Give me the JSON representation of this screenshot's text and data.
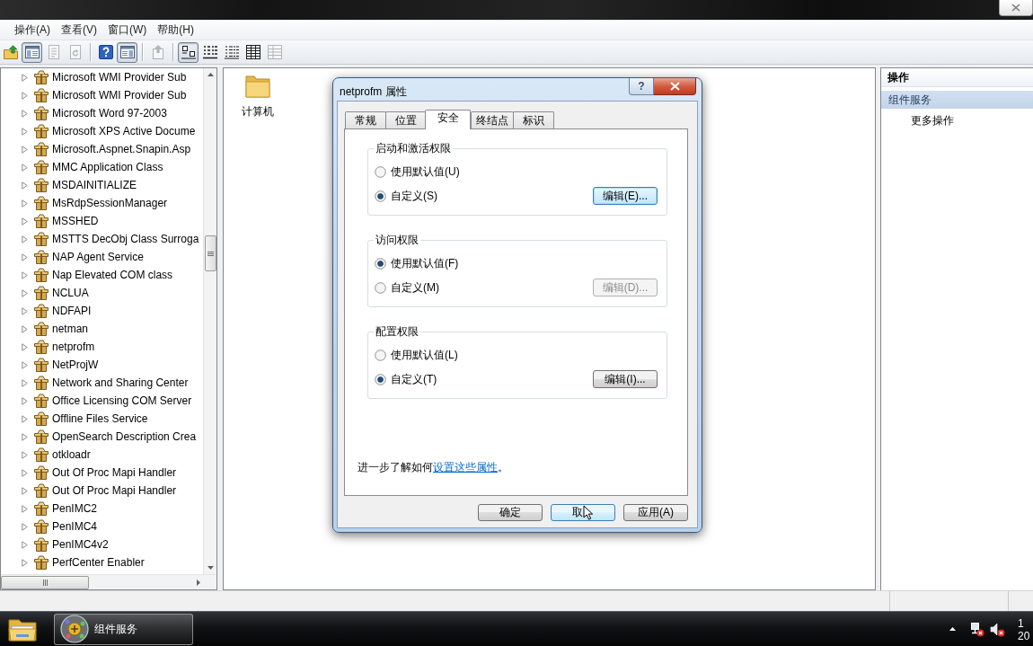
{
  "menu_bar": [
    "操作(A)",
    "查看(V)",
    "窗口(W)",
    "帮助(H)"
  ],
  "toolbar": {
    "groups": [
      [
        {
          "kind": "up",
          "pressed": false,
          "disabled": false
        },
        {
          "kind": "console-tree",
          "pressed": true,
          "disabled": false
        },
        {
          "kind": "properties",
          "pressed": false,
          "disabled": true
        },
        {
          "kind": "refresh",
          "pressed": false,
          "disabled": true
        }
      ],
      [
        {
          "kind": "help",
          "pressed": false,
          "disabled": false
        },
        {
          "kind": "action-pane",
          "pressed": true,
          "disabled": false
        }
      ],
      [
        {
          "kind": "export",
          "pressed": false,
          "disabled": true
        }
      ],
      [
        {
          "kind": "large-icons",
          "pressed": true,
          "disabled": false
        },
        {
          "kind": "small-icons",
          "pressed": false,
          "disabled": false
        },
        {
          "kind": "list",
          "pressed": false,
          "disabled": false
        },
        {
          "kind": "details",
          "pressed": false,
          "disabled": false
        },
        {
          "kind": "customize",
          "pressed": false,
          "disabled": true
        }
      ]
    ]
  },
  "tree": {
    "items": [
      {
        "label": "Microsoft WMI Provider Sub",
        "expanded": false
      },
      {
        "label": "Microsoft WMI Provider Sub",
        "expanded": false
      },
      {
        "label": "Microsoft Word 97-2003",
        "expanded": false
      },
      {
        "label": "Microsoft XPS Active Docume",
        "expanded": false
      },
      {
        "label": "Microsoft.Aspnet.Snapin.Asp",
        "expanded": false
      },
      {
        "label": "MMC Application Class",
        "expanded": false
      },
      {
        "label": "MSDAINITIALIZE",
        "expanded": false
      },
      {
        "label": "MsRdpSessionManager",
        "expanded": false
      },
      {
        "label": "MSSHED",
        "expanded": false
      },
      {
        "label": "MSTTS DecObj Class Surroga",
        "expanded": false
      },
      {
        "label": "NAP Agent Service",
        "expanded": false
      },
      {
        "label": "Nap Elevated COM class",
        "expanded": false
      },
      {
        "label": "NCLUA",
        "expanded": false
      },
      {
        "label": "NDFAPI",
        "expanded": false
      },
      {
        "label": "netman",
        "expanded": false
      },
      {
        "label": "netprofm",
        "expanded": false
      },
      {
        "label": "NetProjW",
        "expanded": false
      },
      {
        "label": "Network and Sharing Center",
        "expanded": false
      },
      {
        "label": "Office Licensing COM Server",
        "expanded": false
      },
      {
        "label": "Offline Files Service",
        "expanded": false
      },
      {
        "label": "OpenSearch Description Crea",
        "expanded": false
      },
      {
        "label": "otkloadr",
        "expanded": false
      },
      {
        "label": "Out Of Proc Mapi Handler",
        "expanded": false
      },
      {
        "label": "Out Of Proc Mapi Handler",
        "expanded": false
      },
      {
        "label": "PenIMC2",
        "expanded": false
      },
      {
        "label": "PenIMC4",
        "expanded": false
      },
      {
        "label": "PenIMC4v2",
        "expanded": false
      },
      {
        "label": "PerfCenter Enabler",
        "expanded": false
      }
    ]
  },
  "content": {
    "items": [
      {
        "kind": "folder",
        "label": "计算机"
      }
    ]
  },
  "actions": {
    "header": "操作",
    "items": [
      {
        "kind": "section",
        "label": "组件服务"
      },
      {
        "kind": "action",
        "label": "更多操作"
      }
    ]
  },
  "dialog": {
    "title": "netprofm 属性",
    "help_button": "?",
    "tabs": [
      {
        "label": "常规",
        "selected": false
      },
      {
        "label": "位置",
        "selected": false
      },
      {
        "label": "安全",
        "selected": true
      },
      {
        "label": "终结点",
        "selected": false
      },
      {
        "label": "标识",
        "selected": false
      }
    ],
    "groups": [
      {
        "title": "启动和激活权限",
        "options": [
          {
            "label": "使用默认值(U)",
            "selected": false
          },
          {
            "label": "自定义(S)",
            "selected": true
          }
        ],
        "button": {
          "label": "编辑(E)...",
          "disabled": false,
          "focused": true
        }
      },
      {
        "title": "访问权限",
        "options": [
          {
            "label": "使用默认值(F)",
            "selected": true
          },
          {
            "label": "自定义(M)",
            "selected": false
          }
        ],
        "button": {
          "label": "编辑(D)...",
          "disabled": true,
          "focused": false
        }
      },
      {
        "title": "配置权限",
        "options": [
          {
            "label": "使用默认值(L)",
            "selected": false
          },
          {
            "label": "自定义(T)",
            "selected": true
          }
        ],
        "button": {
          "label": "编辑(I)...",
          "disabled": false,
          "focused": false
        }
      }
    ],
    "help": {
      "before": "进一步了解如何",
      "link": "设置这些属性",
      "after": "。"
    },
    "buttons": [
      {
        "label": "确定",
        "hovered": false
      },
      {
        "label": "取",
        "hovered": true
      },
      {
        "label": "应用(A)",
        "hovered": false
      }
    ]
  },
  "taskbar": {
    "items": [
      {
        "kind": "explorer"
      },
      {
        "kind": "window",
        "label": "组件服务"
      }
    ],
    "tray": {
      "network": {
        "connected": false
      },
      "volume": {
        "muted": true
      },
      "clock": {
        "time": "1",
        "date": "20"
      }
    }
  }
}
